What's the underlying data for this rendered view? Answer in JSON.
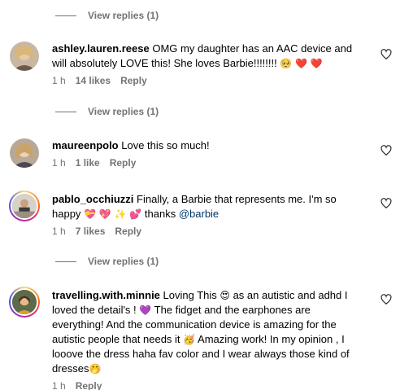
{
  "view_replies_label": "View replies (1)",
  "comments": [
    {
      "username": "ashley.lauren.reese",
      "text_1": "OMG my daughter has an AAC device and",
      "text_2": "will absolutely LOVE this! She loves Barbie!!!!!!!!",
      "emojis": "🥺 ❤️ ❤️",
      "time": "1 h",
      "likes": "14 likes",
      "reply": "Reply"
    },
    {
      "username": "maureenpolo",
      "text_1": "Love this so much!",
      "time": "1 h",
      "likes": "1 like",
      "reply": "Reply"
    },
    {
      "username": "pablo_occhiuzzi",
      "text_1": "Finally, a Barbie that represents me. I'm so",
      "text_2a": "happy",
      "emojis": "💝 💖 ✨ 💕",
      "text_2b": "thanks",
      "mention": "@barbie",
      "time": "1 h",
      "likes": "7 likes",
      "reply": "Reply"
    },
    {
      "username": "travelling.with.minnie",
      "text_1a": "Loving This",
      "emoji_1": "😍",
      "text_1b": "as an autistic and adhd I",
      "text_2a": "loved the detail's !",
      "emoji_2": "💜",
      "text_2b": "The fidget and the earphones are",
      "text_3": "everything! And the communication device is amazing for the",
      "text_4a": "autistic people that needs it",
      "emoji_4": "🥳",
      "text_4b": "Amazing work! In my opinion ,",
      "text_5": "I looove the dress haha fav color and I wear always those kind",
      "text_6": "of dresses",
      "emoji_6": "🤭",
      "time": "1 h",
      "reply": "Reply"
    }
  ],
  "colors": {
    "secondary_text": "#737373",
    "mention": "#00376b"
  },
  "icons": {
    "like": "heart-outline-icon"
  }
}
